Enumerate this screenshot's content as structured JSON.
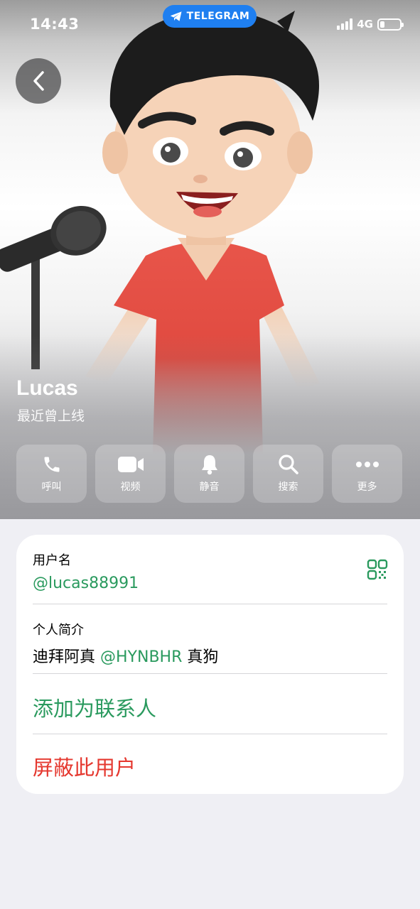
{
  "status_bar": {
    "time": "14:43",
    "network": "4G"
  },
  "app_badge": {
    "label": "TELEGRAM"
  },
  "profile": {
    "name": "Lucas",
    "last_seen": "最近曾上线"
  },
  "actions": [
    {
      "label": "呼叫",
      "icon": "phone-icon"
    },
    {
      "label": "视频",
      "icon": "video-camera-icon"
    },
    {
      "label": "静音",
      "icon": "bell-icon"
    },
    {
      "label": "搜索",
      "icon": "search-icon"
    },
    {
      "label": "更多",
      "icon": "more-dots-icon"
    }
  ],
  "info": {
    "username_label": "用户名",
    "username_value": "@lucas88991",
    "bio_label": "个人简介",
    "bio_text_before": "迪拜阿真 ",
    "bio_mention": "@HYNBHR",
    "bio_text_after": " 真狗",
    "add_contact": "添加为联系人",
    "block_user": "屏蔽此用户"
  },
  "colors": {
    "accent_green": "#2a9a5e",
    "danger_red": "#e5382f",
    "telegram_blue": "#1f7ff0"
  }
}
